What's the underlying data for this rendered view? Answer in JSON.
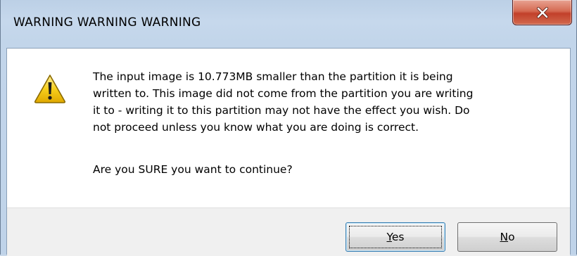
{
  "window": {
    "title": "WARNING WARNING WARNING"
  },
  "titlebar": {
    "close_icon": "close-x-icon"
  },
  "message": {
    "icon": "warning-triangle-icon",
    "lines": [
      "The input image is 10.773MB smaller than the partition it is being",
      "written to.  This image did not come from the partition you are writing",
      "it to - writing it to this partition may not have the effect you wish.  Do",
      "not proceed unless you know what you are doing is correct."
    ],
    "question": "Are you SURE you want to continue?"
  },
  "buttons": {
    "yes": {
      "mnemonic": "Y",
      "rest": "es"
    },
    "no": {
      "mnemonic": "N",
      "rest": "o"
    }
  },
  "colors": {
    "close_button": "#c8452f",
    "warning_yellow": "#f5c400",
    "focus_border": "#3c7fb1"
  }
}
